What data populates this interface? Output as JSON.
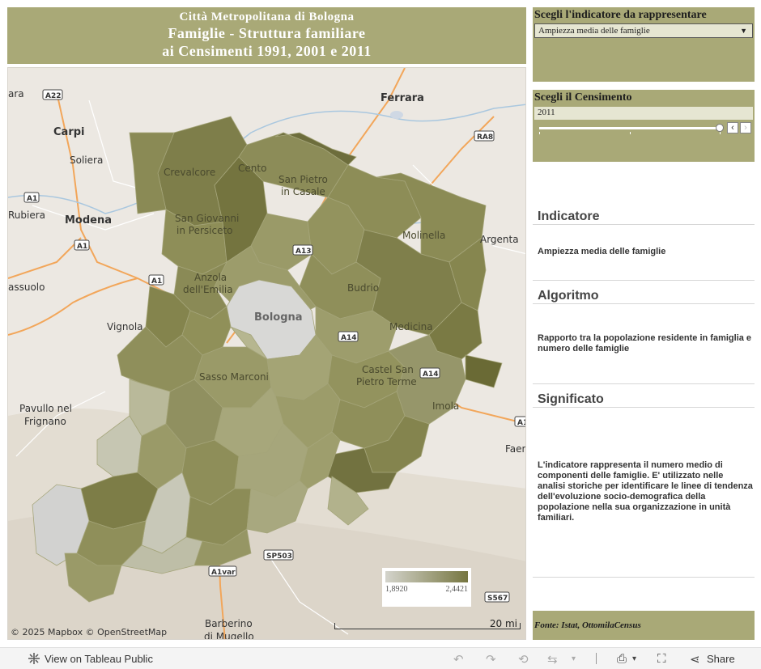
{
  "header": {
    "line1": "Città Metropolitana di Bologna",
    "line2": "Famiglie - Struttura familiare",
    "line3": "ai Censimenti 1991, 2001 e 2011"
  },
  "map": {
    "places": {
      "ferrara": "Ferrara",
      "carpi": "Carpi",
      "soliera": "Soliera",
      "modena": "Modena",
      "rubiera": "Rubiera",
      "sassuolo": "assuolo",
      "vignola": "Vignola",
      "pavullo1": "Pavullo nel",
      "pavullo2": "Frignano",
      "crevalcore": "Crevalcore",
      "cento": "Cento",
      "sanpietro1": "San Pietro",
      "sanpietro2": "in Casale",
      "sangiovanni1": "San Giovanni",
      "sangiovanni2": "in Persiceto",
      "anzola1": "Anzola",
      "anzola2": "dell'Emilia",
      "bologna": "Bologna",
      "budrio": "Budrio",
      "molinella": "Molinella",
      "argenta": "Argenta",
      "medicina": "Medicina",
      "sassomarconi": "Sasso Marconi",
      "castelsanpietro1": "Castel San",
      "castelsanpietro2": "Pietro Terme",
      "imola": "Imola",
      "faenza": "Faen",
      "barberino1": "Barberino",
      "barberino2": "di Mugello",
      "ara": "ara"
    },
    "roads": [
      "A22",
      "RA8",
      "A1",
      "A1",
      "A1",
      "A13",
      "A14",
      "A14",
      "A1var",
      "SP503",
      "S567",
      "A1"
    ],
    "attribution": "© 2025 Mapbox  © OpenStreetMap",
    "scale_label": "20 mi",
    "legend": {
      "min": "1,8920",
      "max": "2,4421"
    }
  },
  "indicator_panel": {
    "title": "Scegli l'indicatore da rappresentare",
    "selected": "Ampiezza media delle famiglie"
  },
  "census_panel": {
    "title": "Scegli il Censimento",
    "selected": "2011"
  },
  "info": {
    "indicatore_title": "Indicatore",
    "indicatore_text": "Ampiezza media delle famiglie",
    "algoritmo_title": "Algoritmo",
    "algoritmo_text": "Rapporto tra la popolazione residente in famiglia e numero delle famiglie",
    "significato_title": "Significato",
    "significato_text": "L'indicatore rappresenta il numero medio di componenti delle famiglie. E' utilizzato nelle analisi storiche per identificare le linee di tendenza dell'evoluzione socio-demografica della popolazione nella sua organizzazione in unità familiari."
  },
  "footer_note": "Fonte: Istat, OttomilaCensus",
  "toolbar": {
    "view_on": "View on Tableau Public",
    "share": "Share"
  },
  "colors": {
    "panel_olive": "#a9a977",
    "choropleth_low": "#d4d4cc",
    "choropleth_high": "#767640"
  }
}
